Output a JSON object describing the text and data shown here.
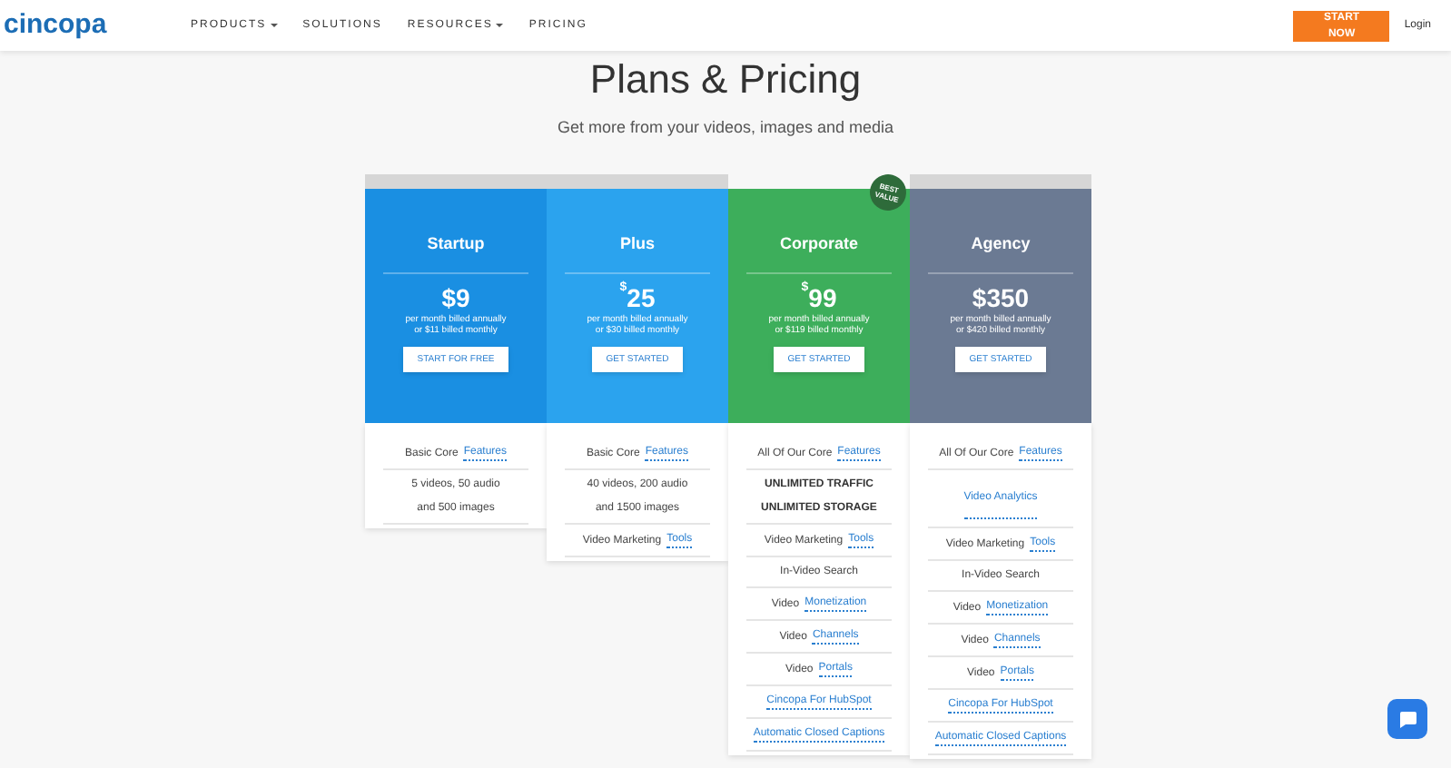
{
  "nav": {
    "logo": "cincopa",
    "items": [
      {
        "label": "PRODUCTS",
        "has_menu": true
      },
      {
        "label": "SOLUTIONS",
        "has_menu": false
      },
      {
        "label": "RESOURCES",
        "has_menu": true
      },
      {
        "label": "PRICING",
        "has_menu": false
      }
    ],
    "cta": "START NOW",
    "login": "Login"
  },
  "hero": {
    "title": "Plans & Pricing",
    "subtitle": "Get more from your videos, images and media"
  },
  "plans": [
    {
      "name": "Startup",
      "color": "#1a8fe2",
      "band": true,
      "currency": "$",
      "amount": "9",
      "raised_currency": false,
      "billing": [
        "per month billed annually",
        "or $11 billed monthly"
      ],
      "button": "START FOR FREE",
      "features": [
        [
          {
            "kind": "mixed",
            "text": "Basic Core",
            "link": "Features"
          }
        ],
        [
          {
            "kind": "plain",
            "text": "5 videos, 50 audio"
          },
          {
            "kind": "plain",
            "text": "and 500 images"
          }
        ]
      ]
    },
    {
      "name": "Plus",
      "color": "#2ba3ee",
      "band": true,
      "currency": "$",
      "amount": "25",
      "raised_currency": true,
      "billing": [
        "per month billed annually",
        "or $30 billed monthly"
      ],
      "button": "GET STARTED",
      "features": [
        [
          {
            "kind": "mixed",
            "text": "Basic Core",
            "link": "Features"
          }
        ],
        [
          {
            "kind": "plain",
            "text": "40 videos, 200 audio"
          },
          {
            "kind": "plain",
            "text": "and 1500 images"
          }
        ],
        [
          {
            "kind": "mixed",
            "text": "Video Marketing",
            "link": "Tools"
          }
        ]
      ]
    },
    {
      "name": "Corporate",
      "color": "#3dae5b",
      "band": false,
      "currency": "$",
      "amount": "99",
      "raised_currency": true,
      "billing": [
        "per month billed annually",
        "or $119 billed monthly"
      ],
      "button": "GET STARTED",
      "badge": [
        "BEST",
        "VALUE"
      ],
      "features": [
        [
          {
            "kind": "mixed",
            "text": "All Of Our Core",
            "link": "Features"
          }
        ],
        [
          {
            "kind": "bold",
            "text": "UNLIMITED TRAFFIC"
          },
          {
            "kind": "bold",
            "text": "UNLIMITED STORAGE"
          }
        ],
        [
          {
            "kind": "mixed",
            "text": "Video Marketing",
            "link": "Tools"
          }
        ],
        [
          {
            "kind": "plain",
            "text": "In-Video Search"
          }
        ],
        [
          {
            "kind": "mixed",
            "text": "Video",
            "link": "Monetization"
          }
        ],
        [
          {
            "kind": "mixed",
            "text": "Video",
            "link": "Channels"
          }
        ],
        [
          {
            "kind": "mixed",
            "text": "Video",
            "link": "Portals"
          }
        ],
        [
          {
            "kind": "link",
            "text": "Cincopa For HubSpot"
          }
        ],
        [
          {
            "kind": "link",
            "text": "Automatic Closed Captions"
          }
        ]
      ]
    },
    {
      "name": "Agency",
      "color": "#6b7a93",
      "band": true,
      "currency": "$",
      "amount": "350",
      "raised_currency": false,
      "billing": [
        "per month billed annually",
        "or $420 billed monthly"
      ],
      "button": "GET STARTED",
      "features": [
        [
          {
            "kind": "mixed",
            "text": "All Of Our Core",
            "link": "Features"
          }
        ],
        [
          {
            "kind": "link",
            "text": "Video Analytics",
            "tall": true
          }
        ],
        [
          {
            "kind": "mixed",
            "text": "Video Marketing",
            "link": "Tools"
          }
        ],
        [
          {
            "kind": "plain",
            "text": "In-Video Search"
          }
        ],
        [
          {
            "kind": "mixed",
            "text": "Video",
            "link": "Monetization"
          }
        ],
        [
          {
            "kind": "mixed",
            "text": "Video",
            "link": "Channels"
          }
        ],
        [
          {
            "kind": "mixed",
            "text": "Video",
            "link": "Portals"
          }
        ],
        [
          {
            "kind": "link",
            "text": "Cincopa For HubSpot"
          }
        ],
        [
          {
            "kind": "link",
            "text": "Automatic Closed Captions"
          }
        ]
      ]
    }
  ]
}
